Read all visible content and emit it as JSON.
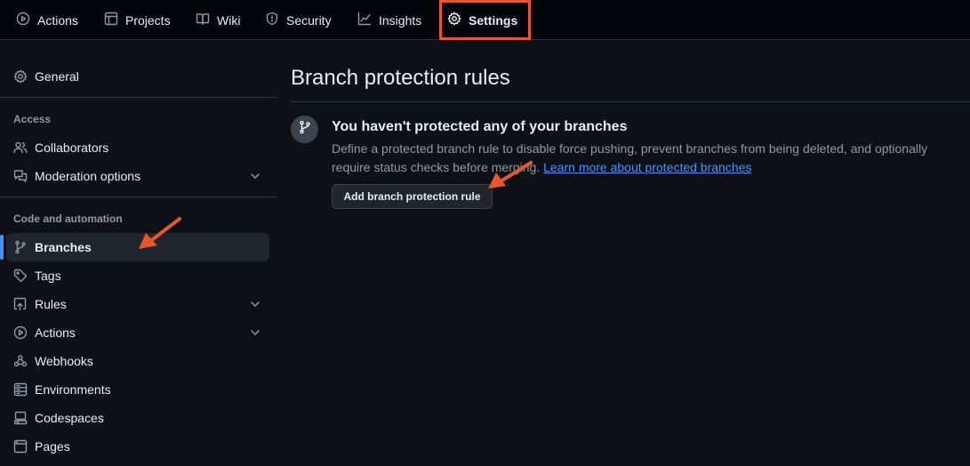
{
  "top_nav": {
    "tabs": [
      {
        "label": "Actions",
        "icon": "play-icon"
      },
      {
        "label": "Projects",
        "icon": "table-icon"
      },
      {
        "label": "Wiki",
        "icon": "book-icon"
      },
      {
        "label": "Security",
        "icon": "shield-icon"
      },
      {
        "label": "Insights",
        "icon": "graph-icon"
      },
      {
        "label": "Settings",
        "icon": "gear-icon",
        "active": true
      }
    ]
  },
  "sidebar": {
    "general": {
      "label": "General",
      "icon": "gear-icon"
    },
    "access_heading": "Access",
    "access_items": [
      {
        "label": "Collaborators",
        "icon": "people-icon"
      },
      {
        "label": "Moderation options",
        "icon": "comment-discussion-icon",
        "expandable": true
      }
    ],
    "automation_heading": "Code and automation",
    "automation_items": [
      {
        "label": "Branches",
        "icon": "git-branch-icon",
        "active": true
      },
      {
        "label": "Tags",
        "icon": "tag-icon"
      },
      {
        "label": "Rules",
        "icon": "repo-push-icon",
        "expandable": true
      },
      {
        "label": "Actions",
        "icon": "play-icon",
        "expandable": true
      },
      {
        "label": "Webhooks",
        "icon": "webhook-icon"
      },
      {
        "label": "Environments",
        "icon": "server-icon"
      },
      {
        "label": "Codespaces",
        "icon": "codespaces-icon"
      },
      {
        "label": "Pages",
        "icon": "browser-icon"
      }
    ]
  },
  "main": {
    "title": "Branch protection rules",
    "blankslate": {
      "icon": "git-branch-icon",
      "heading": "You haven't protected any of your branches",
      "description": "Define a protected branch rule to disable force pushing, prevent branches from being deleted, and optionally require status checks before merging.",
      "link_text": "Learn more about protected branches",
      "button_label": "Add branch protection rule"
    }
  },
  "colors": {
    "background": "#0d1117",
    "nav_background": "#010409",
    "accent_link": "#4493f8",
    "annotation": "#e8572a"
  }
}
